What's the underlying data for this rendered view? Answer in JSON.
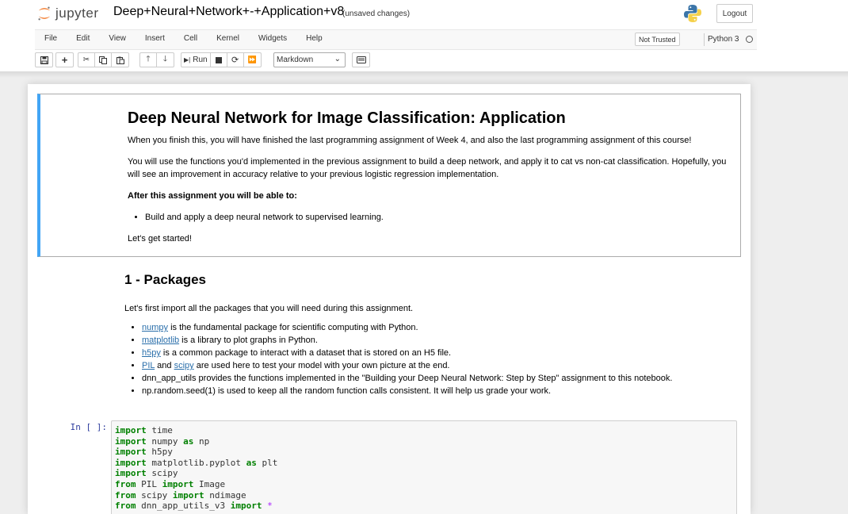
{
  "header": {
    "logo_text": "jupyter",
    "notebook_title": "Deep+Neural+Network+-+Application+v8",
    "save_status": "(unsaved changes)",
    "logout_label": "Logout"
  },
  "menu": {
    "items": [
      "File",
      "Edit",
      "View",
      "Insert",
      "Cell",
      "Kernel",
      "Widgets",
      "Help"
    ],
    "trusted_label": "Not Trusted",
    "kernel_name": "Python 3"
  },
  "toolbar": {
    "run_label": "Run",
    "cell_type": "Markdown"
  },
  "cells": {
    "intro": {
      "title": "Deep Neural Network for Image Classification: Application",
      "p1": "When you finish this, you will have finished the last programming assignment of Week 4, and also the last programming assignment of this course!",
      "p2": "You will use the functions you'd implemented in the previous assignment to build a deep network, and apply it to cat vs non-cat classification. Hopefully, you will see an improvement in accuracy relative to your previous logistic regression implementation.",
      "p3": "After this assignment you will be able to:",
      "bullet1": "Build and apply a deep neural network to supervised learning.",
      "p4": "Let's get started!"
    },
    "packages": {
      "title": "1 - Packages",
      "intro": "Let's first import all the packages that you will need during this assignment.",
      "b1_link": "numpy",
      "b1_text": " is the fundamental package for scientific computing with Python.",
      "b2_link": "matplotlib",
      "b2_text": " is a library to plot graphs in Python.",
      "b3_link": "h5py",
      "b3_text": " is a common package to interact with a dataset that is stored on an H5 file.",
      "b4_link1": "PIL",
      "b4_and": " and ",
      "b4_link2": "scipy",
      "b4_text": " are used here to test your model with your own picture at the end.",
      "b5": "dnn_app_utils provides the functions implemented in the \"Building your Deep Neural Network: Step by Step\" assignment to this notebook.",
      "b6": "np.random.seed(1) is used to keep all the random function calls consistent. It will help us grade your work."
    },
    "code": {
      "prompt": "In [ ]:",
      "lines": [
        [
          {
            "t": "import",
            "k": "kw"
          },
          {
            "t": " time",
            "k": ""
          }
        ],
        [
          {
            "t": "import",
            "k": "kw"
          },
          {
            "t": " numpy ",
            "k": ""
          },
          {
            "t": "as",
            "k": "kw"
          },
          {
            "t": " np",
            "k": ""
          }
        ],
        [
          {
            "t": "import",
            "k": "kw"
          },
          {
            "t": " h5py",
            "k": ""
          }
        ],
        [
          {
            "t": "import",
            "k": "kw"
          },
          {
            "t": " matplotlib.pyplot ",
            "k": ""
          },
          {
            "t": "as",
            "k": "kw"
          },
          {
            "t": " plt",
            "k": ""
          }
        ],
        [
          {
            "t": "import",
            "k": "kw"
          },
          {
            "t": " scipy",
            "k": ""
          }
        ],
        [
          {
            "t": "from",
            "k": "kw"
          },
          {
            "t": " PIL ",
            "k": ""
          },
          {
            "t": "import",
            "k": "kw"
          },
          {
            "t": " Image",
            "k": ""
          }
        ],
        [
          {
            "t": "from",
            "k": "kw"
          },
          {
            "t": " scipy ",
            "k": ""
          },
          {
            "t": "import",
            "k": "kw"
          },
          {
            "t": " ndimage",
            "k": ""
          }
        ],
        [
          {
            "t": "from",
            "k": "kw"
          },
          {
            "t": " dnn_app_utils_v3 ",
            "k": ""
          },
          {
            "t": "import",
            "k": "kw"
          },
          {
            "t": " ",
            "k": ""
          },
          {
            "t": "*",
            "k": "op"
          }
        ]
      ]
    }
  }
}
